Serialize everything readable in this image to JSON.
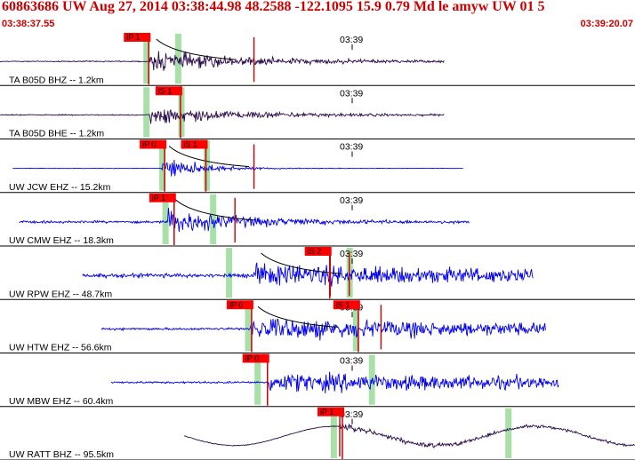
{
  "header": {
    "title": "60863686 UW Aug 27, 2014 03:38:44.98    48.2588 -122.1095 15.9 0.79 Md le amyw UW 01   5",
    "start_time": "03:38:37.55",
    "end_time": "03:39:20.07"
  },
  "colors": {
    "header_text": "#cc0000",
    "trace_dark": "#2a0a4a",
    "trace_blue": "#0000ee",
    "pick_box": "#ff0000",
    "pick_line": "#cc0000",
    "window_band": "#a8e0a8"
  },
  "traces": [
    {
      "label": "TA B05D BHZ -- 1.2km",
      "minute_label": "03:39",
      "color": "dark",
      "start": 0.0,
      "end": 0.7,
      "onset": 0.235,
      "amp": 0.55,
      "noise": 0.03,
      "decay": 0.18,
      "bands": [
        0.23,
        0.28
      ],
      "picks": [
        {
          "text": "iP 1",
          "pos": 0.195
        }
      ],
      "marks": [
        0.4
      ],
      "curve": true
    },
    {
      "label": "TA B05D BHE -- 1.2km",
      "minute_label": "03:39",
      "color": "dark",
      "start": 0.0,
      "end": 0.7,
      "onset": 0.235,
      "amp": 0.5,
      "noise": 0.03,
      "decay": 0.16,
      "bands": [
        0.23,
        0.285
      ],
      "picks": [
        {
          "text": "iS 1",
          "pos": 0.245
        }
      ],
      "marks": [],
      "curve": false
    },
    {
      "label": "UW JCW EHZ -- 15.2km",
      "minute_label": "03:39",
      "color": "blue",
      "start": 0.02,
      "end": 0.73,
      "onset": 0.255,
      "amp": 0.75,
      "noise": 0.01,
      "decay": 0.06,
      "bands": [
        0.255,
        0.325
      ],
      "picks": [
        {
          "text": "iP 0",
          "pos": 0.22
        },
        {
          "text": "iS 1",
          "pos": 0.285
        }
      ],
      "marks": [
        0.4
      ],
      "curve": true
    },
    {
      "label": "UW CMW EHZ -- 18.3km",
      "minute_label": "03:39",
      "color": "blue",
      "start": 0.03,
      "end": 0.74,
      "onset": 0.265,
      "amp": 0.7,
      "noise": 0.07,
      "decay": 0.12,
      "bands": [
        0.26,
        0.335
      ],
      "picks": [
        {
          "text": "iP 1",
          "pos": 0.235
        }
      ],
      "marks": [
        0.37
      ],
      "curve": true
    },
    {
      "label": "UW RPW EHZ -- 48.7km",
      "minute_label": "03:39",
      "color": "blue",
      "start": 0.13,
      "end": 0.84,
      "onset": 0.4,
      "amp": 0.55,
      "noise": 0.12,
      "decay": 0.6,
      "bands": [
        0.36,
        0.55
      ],
      "picks": [
        {
          "text": "iS 2",
          "pos": 0.48
        }
      ],
      "marks": [
        0.52,
        0.55
      ],
      "curve": true
    },
    {
      "label": "UW HTW EHZ -- 56.6km",
      "minute_label": "03:39",
      "color": "blue",
      "start": 0.16,
      "end": 0.86,
      "onset": 0.395,
      "amp": 0.6,
      "noise": 0.07,
      "decay": 0.6,
      "bands": [
        0.39,
        0.56
      ],
      "picks": [
        {
          "text": "iP 0",
          "pos": 0.357
        },
        {
          "text": "iS 1",
          "pos": 0.525
        }
      ],
      "marks": [
        0.6
      ],
      "curve": true
    },
    {
      "label": "UW MBW EHZ -- 60.4km",
      "minute_label": "03:39",
      "color": "blue",
      "start": 0.175,
      "end": 0.88,
      "onset": 0.42,
      "amp": 0.5,
      "noise": 0.06,
      "decay": 0.9,
      "bands": [
        0.405,
        0.585
      ],
      "picks": [
        {
          "text": "iP 0",
          "pos": 0.382
        }
      ],
      "marks": [],
      "curve": false
    },
    {
      "label": "UW RATT BHZ -- 95.5km",
      "minute_label": "03:39",
      "color": "dark",
      "start": 0.29,
      "end": 1.0,
      "onset": 0.535,
      "amp": 0.15,
      "noise": 0.02,
      "decay": 0.5,
      "bands": [
        0.525,
        0.8
      ],
      "picks": [
        {
          "text": "iP 1",
          "pos": 0.5
        }
      ],
      "marks": [
        0.535
      ],
      "curve": false,
      "wave": 0.4
    }
  ]
}
